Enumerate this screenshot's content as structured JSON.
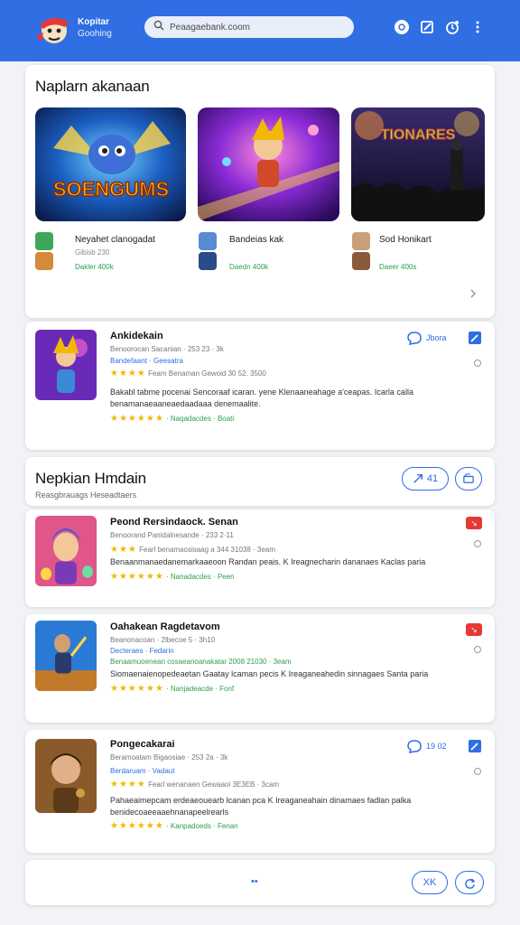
{
  "header": {
    "brand_title": "Kopitar",
    "brand_sub": "Goohing",
    "search_placeholder": "Peaagaebank.coom"
  },
  "featured": {
    "title": "Naplarn akanaan",
    "banner_texts": [
      "SOENGUMS",
      "TIONARES"
    ],
    "items": [
      {
        "name": "Neyahet clanogadat",
        "meta": "Gibisb 230",
        "downloads": "Dakler 400k"
      },
      {
        "name": "Bandeias kak",
        "meta": "",
        "downloads": "Daedn 400k"
      },
      {
        "name": "Sod Honikart",
        "meta": "",
        "downloads": "Daeer 400s"
      }
    ]
  },
  "top_app": {
    "title": "Ankidekain",
    "line1": "Benoorocan Sacanian · 253 23 · 3k",
    "line2": "Bandefaant · Geesatra",
    "rating_line": "Feam Benaman Gewoid 30 52. 3500",
    "desc": "Bakabl tabme pocenai Sencoraaf icaran. yene Klenaaneahage a'ceapas. Icarla calla benamanaeaaneaedaadaaa denemaalite.",
    "footer": "Naqadacdes · Boati",
    "action_label": "Jbora"
  },
  "section2": {
    "title": "Nepkian Hmdain",
    "subtitle": "Reasgbrauags Heseadtaers",
    "pill_label": "41"
  },
  "apps": [
    {
      "title": "Peond Rersindaock. Senan",
      "line1": "Benoorand Panidalnesande · 233 2·11",
      "line2": "",
      "rating_line": "Fearl benamaosisaag a 344 31038 · 3eam",
      "desc": "Benaanmanaedanemarkaaeoon Randan peais. K Ireagnecharin dananaes Kaclas paria",
      "footer": "Nanadacdes · Peen"
    },
    {
      "title": "Oahakean Ragdetavom",
      "line1": "Beanonacoan · 2lbecoe 5 · 3h10",
      "line2": "Decteraes · Fedarin",
      "rating_line": "Benaamuoenean cosaeanoanakatar 2008 21030 · 3eam",
      "desc": "Siomaenaienopedeaetan Gaatay lcaman pecis K Ireaganeahedin sinnagaes Santa paria",
      "footer": "Nanjadeacde · Fonf"
    },
    {
      "title": "Pongecakarai",
      "line1": "Beramoatam Bigaosiae · 253 2a · 3k",
      "line2": "Berdaruam · Vadaut",
      "rating_line": "Fearl wenanaen Gewaaoi 3E3EB · 3cam",
      "desc": "Pahaeaimepcam erdeaeouearb lcanan pca K Ireaganeahain dinamaes fadlan palka benidecoaeeaaehnanapeelrearls",
      "footer": "Kanpadoeds · Fenan",
      "action_label": "19 02"
    }
  ],
  "footer_bar": {
    "page_dots": "••",
    "pill_label": "XK"
  },
  "colors": {
    "brand_blue": "#2f6ee3",
    "star": "#f2b705",
    "green": "#2e9e4f",
    "red": "#e53935"
  }
}
